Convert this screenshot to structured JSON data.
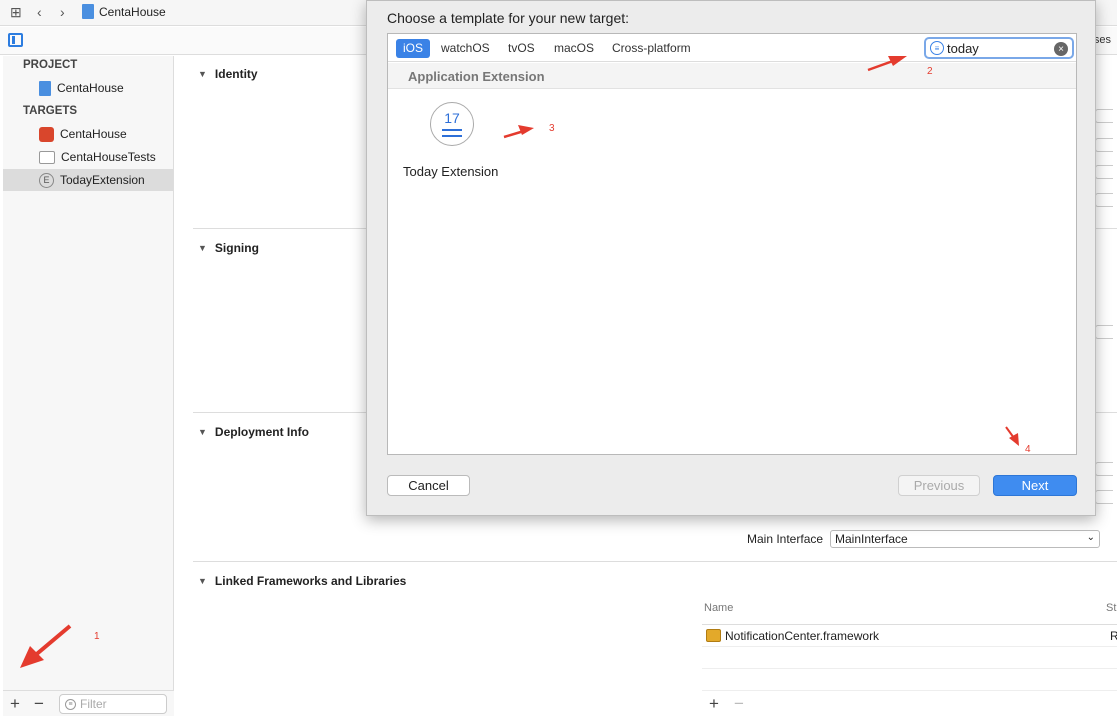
{
  "toolbar": {
    "project_name": "CentaHouse"
  },
  "subbar": {
    "right_cut_text": "ses"
  },
  "navigator": {
    "project_header": "PROJECT",
    "project_item": "CentaHouse",
    "targets_header": "TARGETS",
    "targets": [
      {
        "label": "CentaHouse",
        "icon": "app-icon"
      },
      {
        "label": "CentaHouseTests",
        "icon": "folder-icon"
      },
      {
        "label": "TodayExtension",
        "icon": "extension-icon",
        "selected": true
      }
    ],
    "filter_placeholder": "Filter"
  },
  "editor": {
    "sections": {
      "identity": "Identity",
      "signing": "Signing",
      "deployment": "Deployment Info",
      "linked": "Linked Frameworks and Libraries"
    },
    "main_interface_label": "Main Interface",
    "main_interface_value": "MainInterface",
    "frameworks_name_header": "Name",
    "frameworks_status_header": "St",
    "frameworks": [
      {
        "name": "NotificationCenter.framework",
        "status": "R"
      }
    ]
  },
  "sheet": {
    "title": "Choose a template for your new target:",
    "tabs": [
      "iOS",
      "watchOS",
      "tvOS",
      "macOS",
      "Cross-platform"
    ],
    "active_tab": "iOS",
    "search_value": "today",
    "category": "Application Extension",
    "template": {
      "icon_number": "17",
      "label": "Today Extension"
    },
    "buttons": {
      "cancel": "Cancel",
      "previous": "Previous",
      "next": "Next"
    }
  },
  "annotations": [
    "1",
    "2",
    "3",
    "4"
  ],
  "colors": {
    "accent": "#3a82e6",
    "annotation": "#e43b2e"
  }
}
